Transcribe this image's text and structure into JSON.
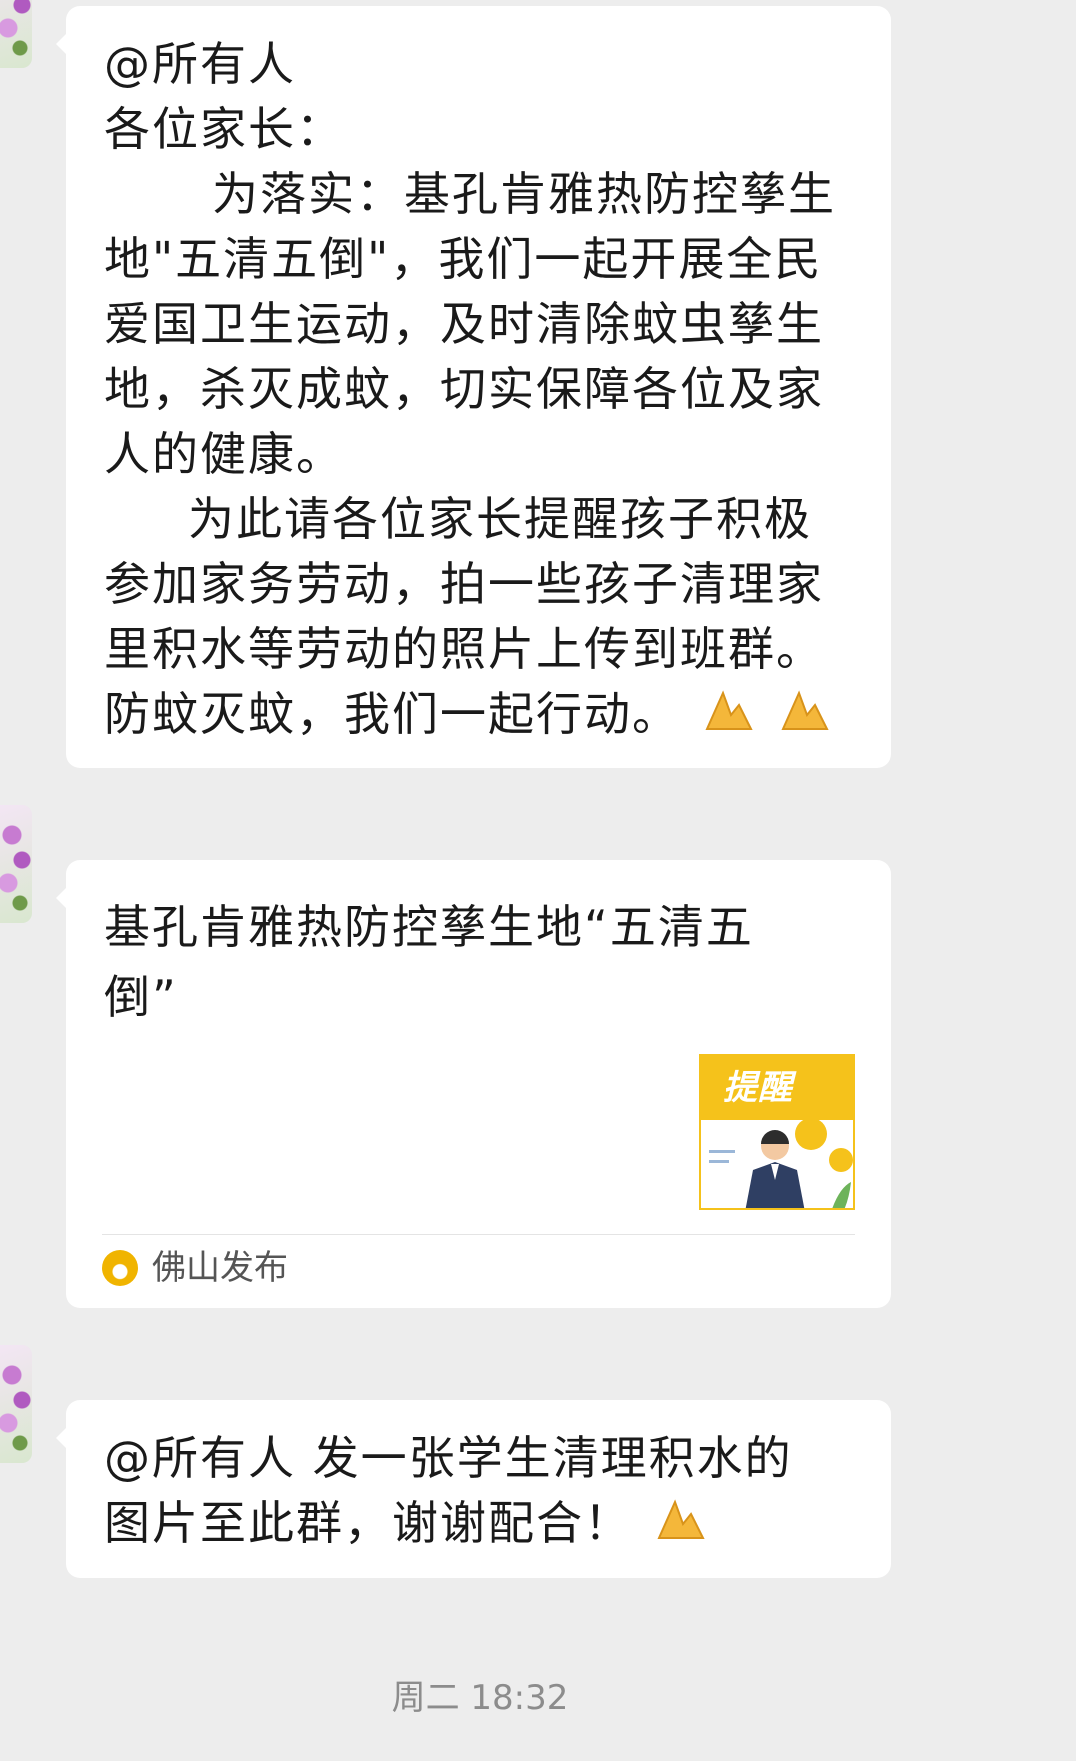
{
  "messages": [
    {
      "type": "text",
      "lines": [
        "@所有人",
        "各位家长：",
        "为落实：基孔肯雅热防控孳生",
        "地\"五清五倒\"，我们一起开展全民",
        "爱国卫生运动，及时清除蚊虫孳生",
        "地，杀灭成蚊，切实保障各位及家",
        "人的健康。",
        "为此请各位家长提醒孩子积极",
        "参加家务劳动，拍一些孩子清理家",
        "里积水等劳动的照片上传到班群。",
        "防蚊灭蚊，我们一起行动。"
      ]
    },
    {
      "type": "card",
      "title_lines": [
        "基孔肯雅热防控孳生地“五清五",
        "倒”"
      ],
      "thumbnail_text": "提醒",
      "source": "佛山发布"
    },
    {
      "type": "text",
      "lines": [
        "@所有人  发一张学生清理积水的",
        "图片至此群，谢谢配合！"
      ]
    }
  ],
  "timestamp": "周二 18:32",
  "colors": {
    "background": "#ededed",
    "bubble": "#ffffff",
    "accent_yellow": "#f5c21b"
  }
}
